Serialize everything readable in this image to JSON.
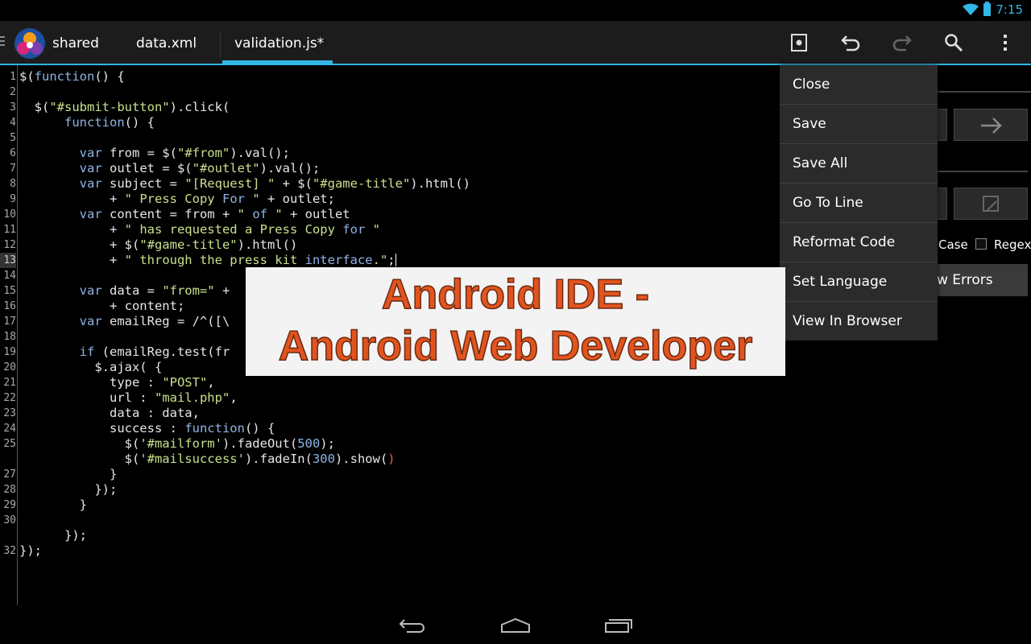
{
  "status_bar": {
    "time": "7:15"
  },
  "action_bar": {
    "app_title": "shared",
    "tabs": [
      {
        "label": "data.xml"
      },
      {
        "label": "validation.js*"
      }
    ]
  },
  "editor": {
    "lines": [
      {
        "num": "1"
      },
      {
        "num": "2"
      },
      {
        "num": "3"
      },
      {
        "num": "4"
      },
      {
        "num": "5"
      },
      {
        "num": "6"
      },
      {
        "num": "7"
      },
      {
        "num": "8"
      },
      {
        "num": "9"
      },
      {
        "num": "10"
      },
      {
        "num": "11"
      },
      {
        "num": "12"
      },
      {
        "num": "13"
      },
      {
        "num": "14"
      },
      {
        "num": "15"
      },
      {
        "num": "16"
      },
      {
        "num": "17"
      },
      {
        "num": "18"
      },
      {
        "num": "19"
      },
      {
        "num": "20"
      },
      {
        "num": "21"
      },
      {
        "num": "22"
      },
      {
        "num": "23"
      },
      {
        "num": "24"
      },
      {
        "num": "25"
      },
      {
        "num": ""
      },
      {
        "num": "27"
      },
      {
        "num": "28"
      },
      {
        "num": "29"
      },
      {
        "num": "30"
      },
      {
        "num": ""
      },
      {
        "num": "32"
      }
    ]
  },
  "side_panel": {
    "case_label": "Case",
    "regex_label": "Regex",
    "errors_label": "w Errors"
  },
  "menu": {
    "items": [
      {
        "label": "Close"
      },
      {
        "label": "Save"
      },
      {
        "label": "Save All"
      },
      {
        "label": "Go To Line"
      },
      {
        "label": "Reformat Code"
      },
      {
        "label": "Set Language"
      },
      {
        "label": "View In Browser"
      }
    ]
  },
  "banner": {
    "line1": "Android IDE -",
    "line2": "Android Web Developer"
  },
  "colors": {
    "accent": "#33b5e5",
    "error_marker": "#8b0e12",
    "banner_text": "#e2541f"
  }
}
